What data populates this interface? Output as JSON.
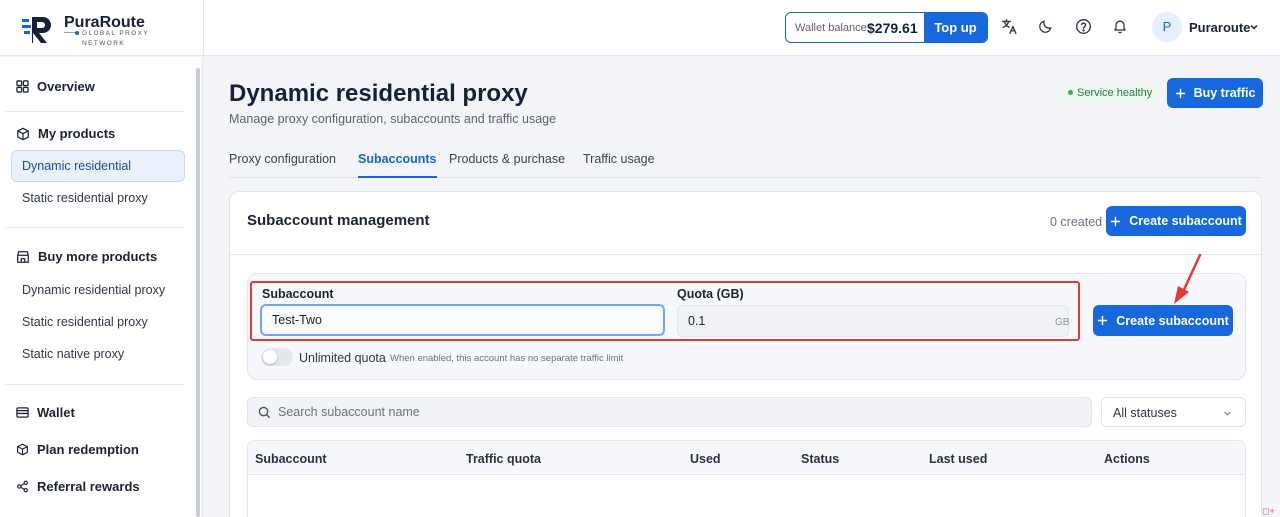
{
  "header": {
    "brand_name": "PuraRoute",
    "brand_tagline": "GLOBAL PROXY NETWORK",
    "wallet_label": "Wallet balance",
    "wallet_balance": "$279.61",
    "topup_label": "Top up",
    "icons": [
      "translate-icon",
      "moon-icon",
      "help-icon",
      "bell-icon"
    ],
    "user_initial": "P",
    "user_name": "Puraroute"
  },
  "sidebar": {
    "overview": "Overview",
    "my_products": "My products",
    "my_products_items": [
      "Dynamic residential",
      "Static residential proxy"
    ],
    "buy_more": "Buy more products",
    "buy_more_items": [
      "Dynamic residential proxy",
      "Static residential proxy",
      "Static native proxy"
    ],
    "wallet": "Wallet",
    "plan_redemption": "Plan redemption",
    "referral_rewards": "Referral rewards"
  },
  "page": {
    "title": "Dynamic residential proxy",
    "subtitle": "Manage proxy configuration, subaccounts and traffic usage",
    "health_badge": "Service healthy",
    "buy_traffic_label": "Buy traffic",
    "tabs": [
      {
        "label": "Proxy configuration",
        "active": false
      },
      {
        "label": "Subaccounts",
        "active": true
      },
      {
        "label": "Products & purchase",
        "active": false
      },
      {
        "label": "Traffic usage",
        "active": false
      }
    ]
  },
  "subaccounts": {
    "title": "Subaccount management",
    "created_count": "0 created",
    "create_label": "Create subaccount",
    "form": {
      "subaccount_label": "Subaccount",
      "subaccount_value": "Test-Two",
      "quota_label": "Quota (GB)",
      "quota_value": "0.1",
      "quota_unit": "GB",
      "submit_label": "Create subaccount",
      "unlimited_label": "Unlimited quota",
      "unlimited_help": "When enabled, this account has no separate traffic limit",
      "unlimited_enabled": false
    },
    "search_placeholder": "Search subaccount name",
    "status_filter": "All statuses",
    "table_headers": [
      "Subaccount",
      "Traffic quota",
      "Used",
      "Status",
      "Last used",
      "Actions"
    ]
  },
  "colors": {
    "primary": "#1668dc",
    "annotation": "#e53935",
    "health": "#2fb35a"
  }
}
